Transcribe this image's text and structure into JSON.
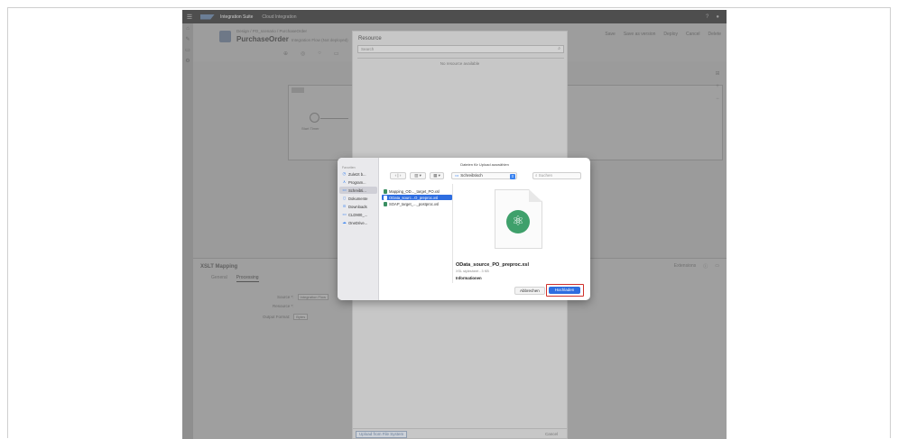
{
  "shell": {
    "product": "Integration Suite",
    "tenant": "Cloud Integration"
  },
  "header": {
    "breadcrumb": "Design / PO_scenario / PurchaseOrder",
    "title": "PurchaseOrder",
    "subtitle": "Integration Flow (Not deployed)",
    "actions": [
      "Save",
      "Save as version",
      "Deploy",
      "Cancel",
      "Delete"
    ],
    "search_placeholder": "Search Step"
  },
  "canvas": {
    "start_label": "Start Timer"
  },
  "props": {
    "title": "XSLT Mapping",
    "right_label": "Extensions",
    "tabs": [
      {
        "label": "General"
      },
      {
        "label": "Processing"
      }
    ],
    "source_label": "Source *:",
    "source_value": "Integration Flow",
    "resource_label": "Resource *:",
    "output_label": "Output Format:",
    "output_value": "Bytes"
  },
  "resource_dialog": {
    "title": "Resource",
    "search_placeholder": "Search",
    "empty_text": "No resource available",
    "upload_label": "Upload from File System",
    "cancel_label": "Cancel"
  },
  "file_dialog": {
    "title": "Dateien für Upload auswählen",
    "sidebar_heading": "Favoriten",
    "sidebar": [
      {
        "label": "Zuletzt b...",
        "icon": "clock-icon"
      },
      {
        "label": "Program...",
        "icon": "apps-icon"
      },
      {
        "label": "Schreibti...",
        "icon": "desktop-icon"
      },
      {
        "label": "Dokumente",
        "icon": "document-icon"
      },
      {
        "label": "Downloads",
        "icon": "download-icon"
      },
      {
        "label": "CLD900_...",
        "icon": "folder-icon"
      },
      {
        "label": "OneDrive...",
        "icon": "cloud-icon"
      }
    ],
    "location": "Schreibtisch",
    "search_placeholder": "Suchen",
    "files": [
      {
        "name": "Mapping_OD..._target_PO.xsl"
      },
      {
        "name": "OData_sourc...O_preproc.xsl"
      },
      {
        "name": "SOAP_target_..._postproc.xsl"
      }
    ],
    "preview": {
      "filename": "OData_source_PO_preproc.xsl",
      "meta": "XSL stylesheet - 3 KB",
      "info_label": "Informationen"
    },
    "cancel_label": "Abbrechen",
    "upload_label": "Hochladen",
    "highlight_color": "#d0302b",
    "accent_color": "#2e6de0"
  }
}
